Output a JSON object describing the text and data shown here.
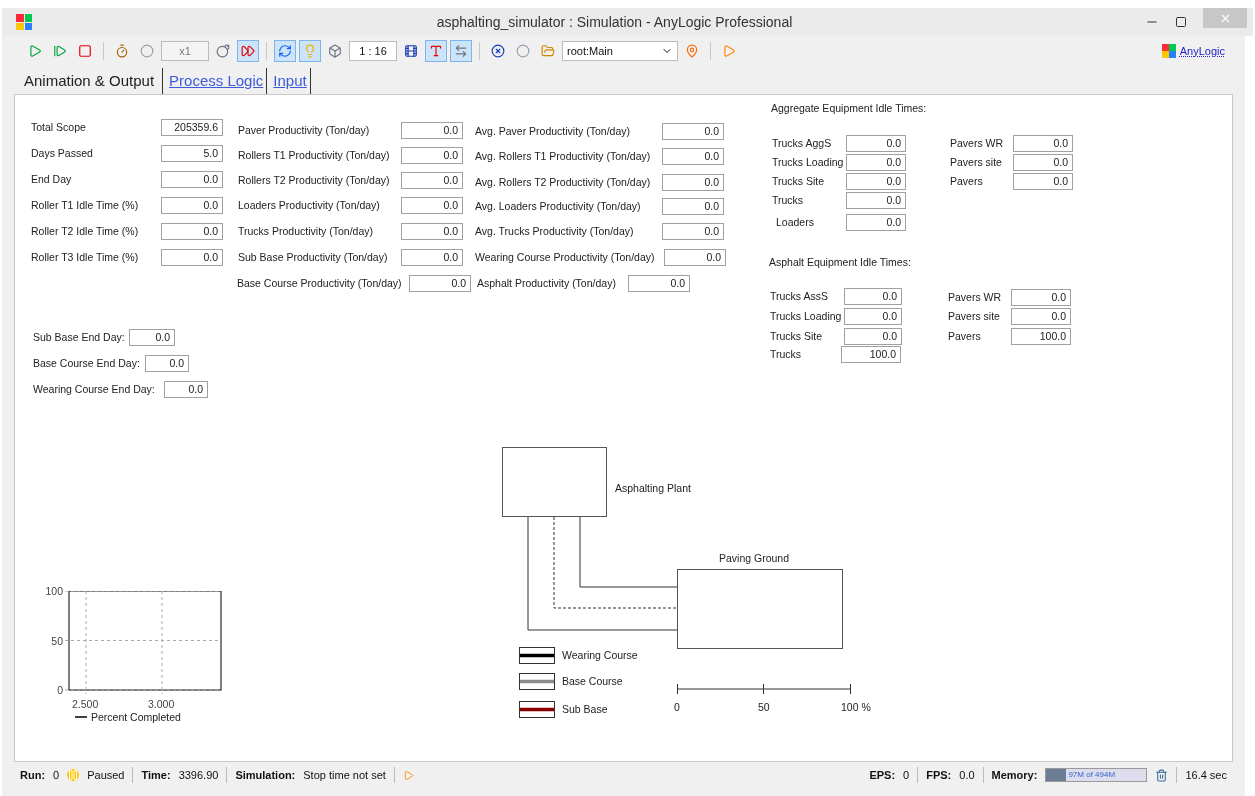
{
  "window": {
    "title": "asphalting_simulator : Simulation - AnyLogic Professional"
  },
  "toolbar": {
    "buttons": [
      {
        "selected": false
      },
      {
        "selected": false
      },
      {
        "selected": false
      },
      {
        "selected": false
      },
      {
        "selected": false
      },
      {
        "selected": false
      },
      {
        "selected": true
      },
      {
        "selected": true
      },
      {
        "selected": true
      },
      {
        "selected": false
      },
      {
        "selected": false
      },
      {
        "selected": true
      },
      {
        "selected": true
      },
      {
        "selected": false
      },
      {
        "selected": false
      },
      {
        "selected": false
      },
      {
        "selected": false
      },
      {
        "selected": false
      }
    ],
    "speed": "x1",
    "scale": "1 : 16",
    "model": "root:Main",
    "brand": "AnyLogic"
  },
  "tabs": [
    {
      "label": "Animation & Output",
      "selected": true
    },
    {
      "label": "Process Logic",
      "selected": false
    },
    {
      "label": "Input",
      "selected": false
    }
  ],
  "summary": [
    {
      "label": "Total Scope",
      "value": "205359.6"
    },
    {
      "label": "Days Passed",
      "value": "5.0"
    },
    {
      "label": "End Day",
      "value": "0.0"
    },
    {
      "label": "Roller T1 Idle Time (%)",
      "value": "0.0"
    },
    {
      "label": "Roller T2 Idle Time (%)",
      "value": "0.0"
    },
    {
      "label": "Roller T3 Idle Time (%)",
      "value": "0.0"
    }
  ],
  "productivity": [
    {
      "label": "Paver Productivity (Ton/day)",
      "value": "0.0"
    },
    {
      "label": "Rollers T1 Productivity (Ton/day)",
      "value": "0.0"
    },
    {
      "label": "Rollers T2 Productivity (Ton/day)",
      "value": "0.0"
    },
    {
      "label": "Loaders Productivity (Ton/day)",
      "value": "0.0"
    },
    {
      "label": "Trucks Productivity (Ton/day)",
      "value": "0.0"
    },
    {
      "label": "Sub Base Productivity (Ton/day)",
      "value": "0.0"
    },
    {
      "label": "Base Course Productivity (Ton/day)",
      "value": "0.0"
    }
  ],
  "avg_productivity": [
    {
      "label": "Avg. Paver Productivity (Ton/day)",
      "value": "0.0"
    },
    {
      "label": "Avg. Rollers T1 Productivity (Ton/day)",
      "value": "0.0"
    },
    {
      "label": "Avg. Rollers T2 Productivity (Ton/day)",
      "value": "0.0"
    },
    {
      "label": "Avg. Loaders Productivity (Ton/day)",
      "value": "0.0"
    },
    {
      "label": "Avg. Trucks Productivity (Ton/day)",
      "value": "0.0"
    },
    {
      "label": "Wearing Course Productivity (Ton/day)",
      "value": "0.0"
    },
    {
      "label": "Asphalt Productivity (Ton/day)",
      "value": "0.0"
    }
  ],
  "end_days": [
    {
      "label": "Sub Base End Day:",
      "value": "0.0"
    },
    {
      "label": "Base Course End Day:",
      "value": "0.0"
    },
    {
      "label": "Wearing Course End Day:",
      "value": "0.0"
    }
  ],
  "aggregate_idle": {
    "title": "Aggregate Equipment Idle Times:",
    "left": [
      {
        "label": "Trucks AggS",
        "value": "0.0"
      },
      {
        "label": "Trucks Loading",
        "value": "0.0"
      },
      {
        "label": "Trucks Site",
        "value": "0.0"
      },
      {
        "label": "Trucks",
        "value": "0.0"
      },
      {
        "label": "Loaders",
        "value": "0.0"
      }
    ],
    "right": [
      {
        "label": "Pavers WR",
        "value": "0.0"
      },
      {
        "label": "Pavers site",
        "value": "0.0"
      },
      {
        "label": "Pavers",
        "value": "0.0"
      }
    ]
  },
  "asphalt_idle": {
    "title": "Asphalt Equipment Idle Times:",
    "left": [
      {
        "label": "Trucks AssS",
        "value": "0.0"
      },
      {
        "label": "Trucks Loading",
        "value": "0.0"
      },
      {
        "label": "Trucks Site",
        "value": "0.0"
      },
      {
        "label": "Trucks",
        "value": "100.0"
      }
    ],
    "right": [
      {
        "label": "Pavers WR",
        "value": "0.0"
      },
      {
        "label": "Pavers site",
        "value": "0.0"
      },
      {
        "label": "Pavers",
        "value": "100.0"
      }
    ]
  },
  "diagram": {
    "plant": "Asphalting Plant",
    "ground": "Paving Ground",
    "legend": [
      {
        "label": "Wearing Course",
        "color": "#000000"
      },
      {
        "label": "Base Course",
        "color": "#8c8c8c"
      },
      {
        "label": "Sub Base",
        "color": "#8b0000"
      }
    ],
    "scale": [
      "0",
      "50",
      "100 %"
    ]
  },
  "chart": {
    "chart_data": {
      "type": "line",
      "grid": true,
      "categories": [
        "2.500",
        "3.000"
      ],
      "ylim": [
        0,
        100
      ],
      "yticks": [
        0,
        50,
        100
      ],
      "series": [
        {
          "name": "Percent Completed",
          "color": "#000000",
          "values": [
            null,
            null
          ]
        }
      ]
    }
  },
  "status_bar": {
    "run_label": "Run:",
    "run": "0",
    "state": "Paused",
    "time_label": "Time:",
    "time": "3396.90",
    "sim_label": "Simulation:",
    "sim": "Stop time not set",
    "eps_label": "EPS:",
    "eps": "0",
    "fps_label": "FPS:",
    "fps": "0.0",
    "memory_label": "Memory:",
    "memory": {
      "text": "97M of 494M",
      "level": 0.196
    },
    "elapsed": "16.4 sec"
  }
}
